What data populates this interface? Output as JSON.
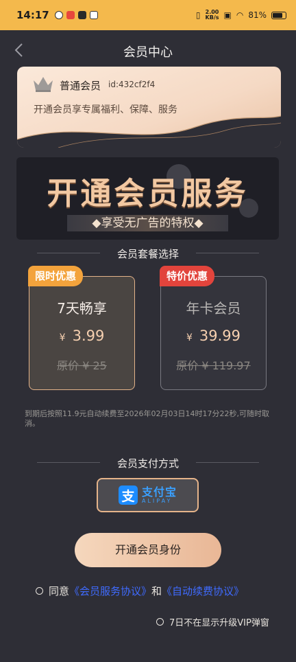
{
  "status": {
    "time": "14:17",
    "net_speed_value": "2.00",
    "net_speed_unit": "KB/s",
    "battery": "81%",
    "battery_level": 0.81
  },
  "header": {
    "title": "会员中心"
  },
  "card": {
    "level": "普通会员",
    "uid": "id:432cf2f4",
    "desc": "开通会员享专属福利、保障、服务"
  },
  "banner": {
    "headline": "开通会员服务",
    "subline": "◆享受无广告的特权◆"
  },
  "plans_title": "会员套餐选择",
  "plans": [
    {
      "tag": "限时优惠",
      "name": "7天畅享",
      "currency": "¥",
      "price": "3.99",
      "original": "原价 ¥ 25",
      "selected": true
    },
    {
      "tag": "特价优惠",
      "name": "年卡会员",
      "currency": "¥",
      "price": "39.99",
      "original": "原价 ¥ 119.97",
      "selected": false
    }
  ],
  "notice": "到期后按照11.9元自动续费至2026年02月03日14时17分22秒,可随时取消。",
  "pay_title": "会员支付方式",
  "pay": {
    "cn": "支付宝",
    "en": "ALIPAY",
    "logo": "支"
  },
  "open_button": "开通会员身份",
  "agree": {
    "prefix": "同意",
    "link1": "《会员服务协议》",
    "and": "和",
    "link2": "《自动续费协议》"
  },
  "popup_option": "7日不在显示升级VIP弹窗",
  "colors": {
    "accent": "#f4b94c",
    "link": "#3f6bff",
    "alipay": "#1d8cff",
    "tag_orange": "#f3a33c",
    "tag_red": "#e2443c"
  }
}
